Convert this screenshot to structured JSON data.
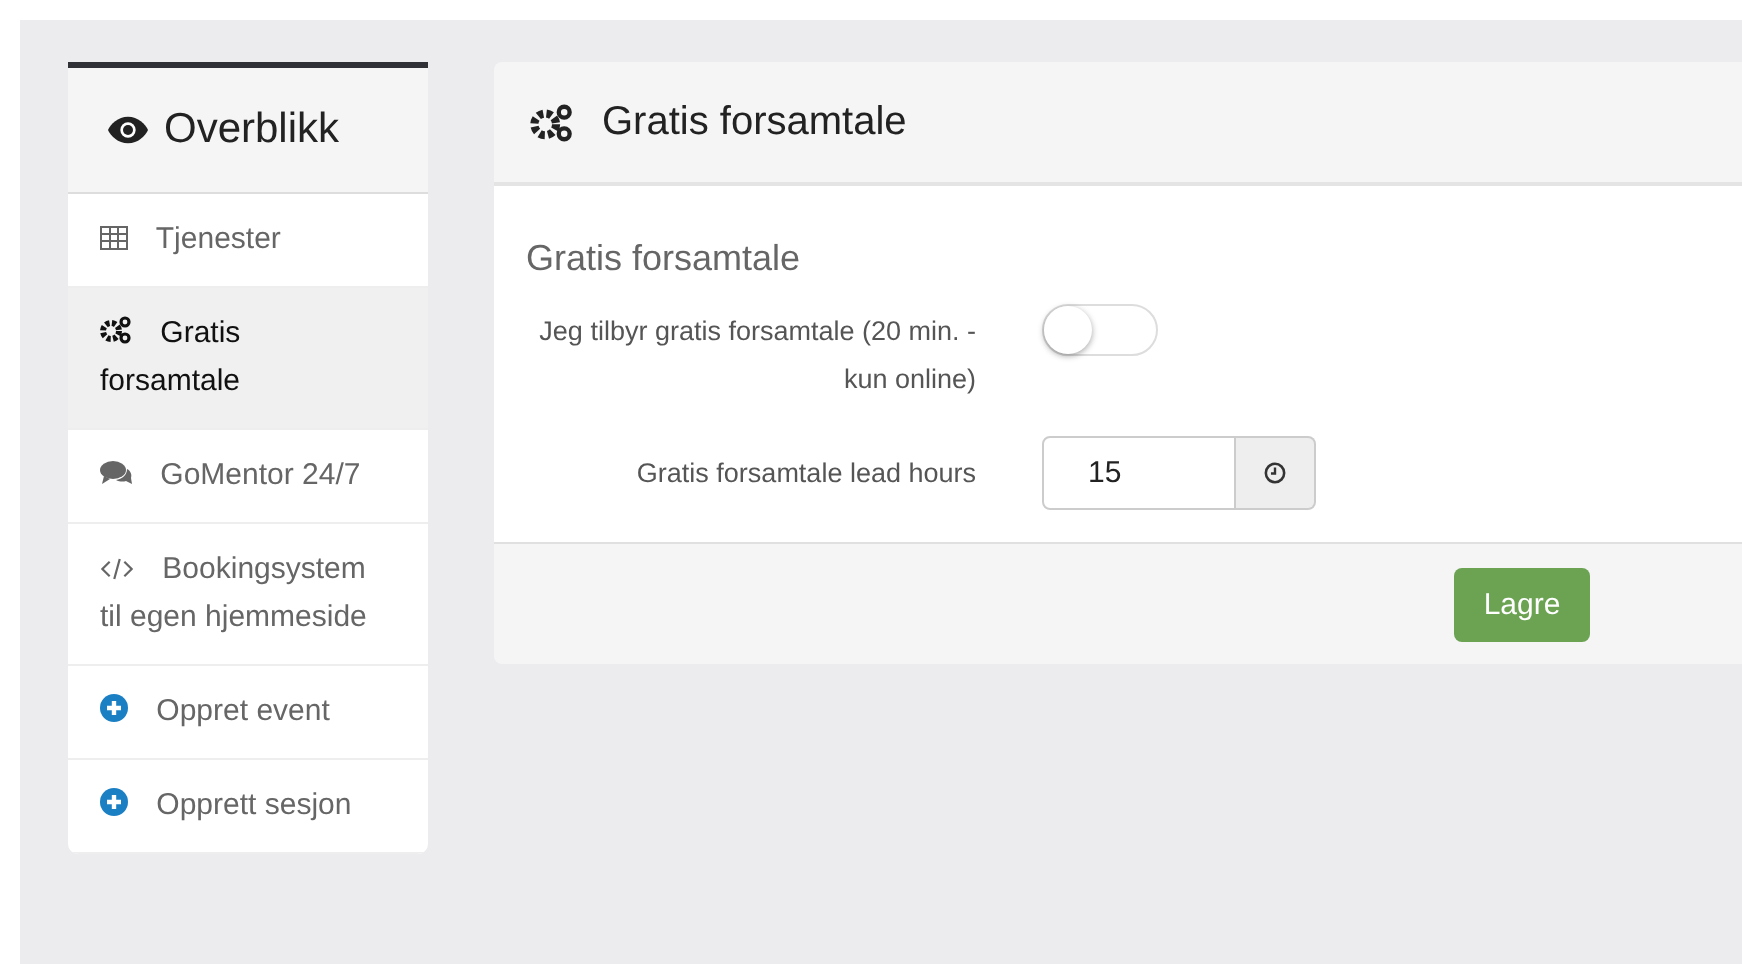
{
  "sidebar": {
    "title": "Overblikk",
    "items": [
      {
        "label": "Tjenester",
        "selected": false
      },
      {
        "label": "Gratis forsamtale",
        "selected": true
      },
      {
        "label": "GoMentor 24/7",
        "selected": false
      },
      {
        "label": "Bookingsystem til egen hjemmeside",
        "selected": false
      },
      {
        "label": "Oppret event",
        "selected": false
      },
      {
        "label": "Opprett sesjon",
        "selected": false
      }
    ]
  },
  "panel": {
    "title": "Gratis forsamtale",
    "section_title": "Gratis forsamtale",
    "toggle": {
      "label": "Jeg tilbyr gratis forsamtale (20 min. - kun online)",
      "on": false
    },
    "lead_hours": {
      "label": "Gratis forsamtale lead hours",
      "value": "15"
    },
    "save_button": "Lagre"
  }
}
